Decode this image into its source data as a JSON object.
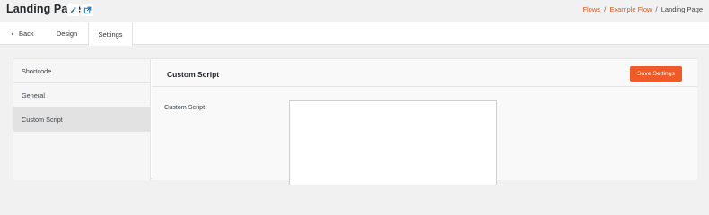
{
  "header": {
    "title": "Landing Page",
    "edit_icon": "pencil-icon",
    "external_icon": "external-link-icon"
  },
  "breadcrumb": {
    "items": [
      "Flows",
      "Example Flow",
      "Landing Page"
    ],
    "separator": "/"
  },
  "tabs": {
    "back_label": "Back",
    "design_label": "Design",
    "settings_label": "Settings",
    "active": "Settings"
  },
  "sidebar": {
    "items": [
      {
        "label": "Shortcode"
      },
      {
        "label": "General"
      },
      {
        "label": "Custom Script"
      }
    ],
    "active": "Custom Script"
  },
  "panel": {
    "title": "Custom Script",
    "save_label": "Save Settings",
    "field_label": "Custom Script",
    "field_value": ""
  },
  "colors": {
    "accent": "#f05a28",
    "link": "#e2581e",
    "active_sidebar": "#e2e2e2"
  }
}
